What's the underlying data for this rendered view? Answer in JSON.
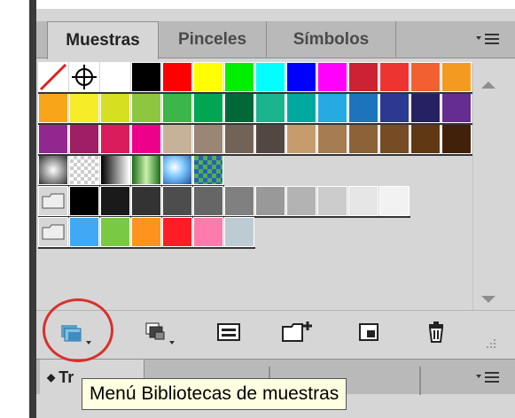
{
  "tabs": [
    {
      "label": "Muestras",
      "active": true
    },
    {
      "label": "Pinceles",
      "active": false
    },
    {
      "label": "Símbolos",
      "active": false
    }
  ],
  "panel_menu_icon": "panel-menu-icon",
  "swatch_rows": [
    [
      "none",
      "registration",
      "#ffffff",
      "#000000",
      "#ff0000",
      "#ffff00",
      "#00ee00",
      "#00ffff",
      "#0000ff",
      "#ff00ff",
      "#cc2233",
      "#ee3333",
      "#f06030",
      "#f49a20"
    ],
    [
      "#f9a51a",
      "#f6ec27",
      "#d6e021",
      "#8ec63f",
      "#3cb54a",
      "#00a651",
      "#006838",
      "#1bb48e",
      "#00a99d",
      "#27aae1",
      "#1c75bc",
      "#2b3990",
      "#262262",
      "#652d90"
    ],
    [
      "#92278f",
      "#9e1f63",
      "#da1c5c",
      "#ec008c",
      "#c7b299",
      "#998675",
      "#736357",
      "#534741",
      "#c69c6d",
      "#a67c52",
      "#8c6239",
      "#754c24",
      "#603813",
      "#42210b"
    ]
  ],
  "gradient_row": [
    "radial-gray",
    "checker",
    "linear-gray",
    "green-cylinder",
    "blue-sphere",
    "blue-pattern"
  ],
  "gray_group": [
    "#000000",
    "#1a1a1a",
    "#333333",
    "#4d4d4d",
    "#666666",
    "#808080",
    "#999999",
    "#b3b3b3",
    "#cccccc",
    "#e6e6e6",
    "#f2f2f2"
  ],
  "bright_group": [
    "#3fa9f5",
    "#7ac943",
    "#ff931e",
    "#ff1d25",
    "#ff7bac",
    "#bdccd4"
  ],
  "toolbar": {
    "icons": [
      "swatch-libraries-menu-icon",
      "show-swatch-kinds-icon",
      "swatch-options-icon",
      "new-color-group-icon",
      "new-swatch-icon",
      "delete-swatch-icon"
    ]
  },
  "panel2": {
    "visible_text": "Tr"
  },
  "tooltip": "Menú Bibliotecas de muestras",
  "colors": {
    "highlight_circle": "#d9302c",
    "tooltip_bg": "#ffffe1"
  }
}
